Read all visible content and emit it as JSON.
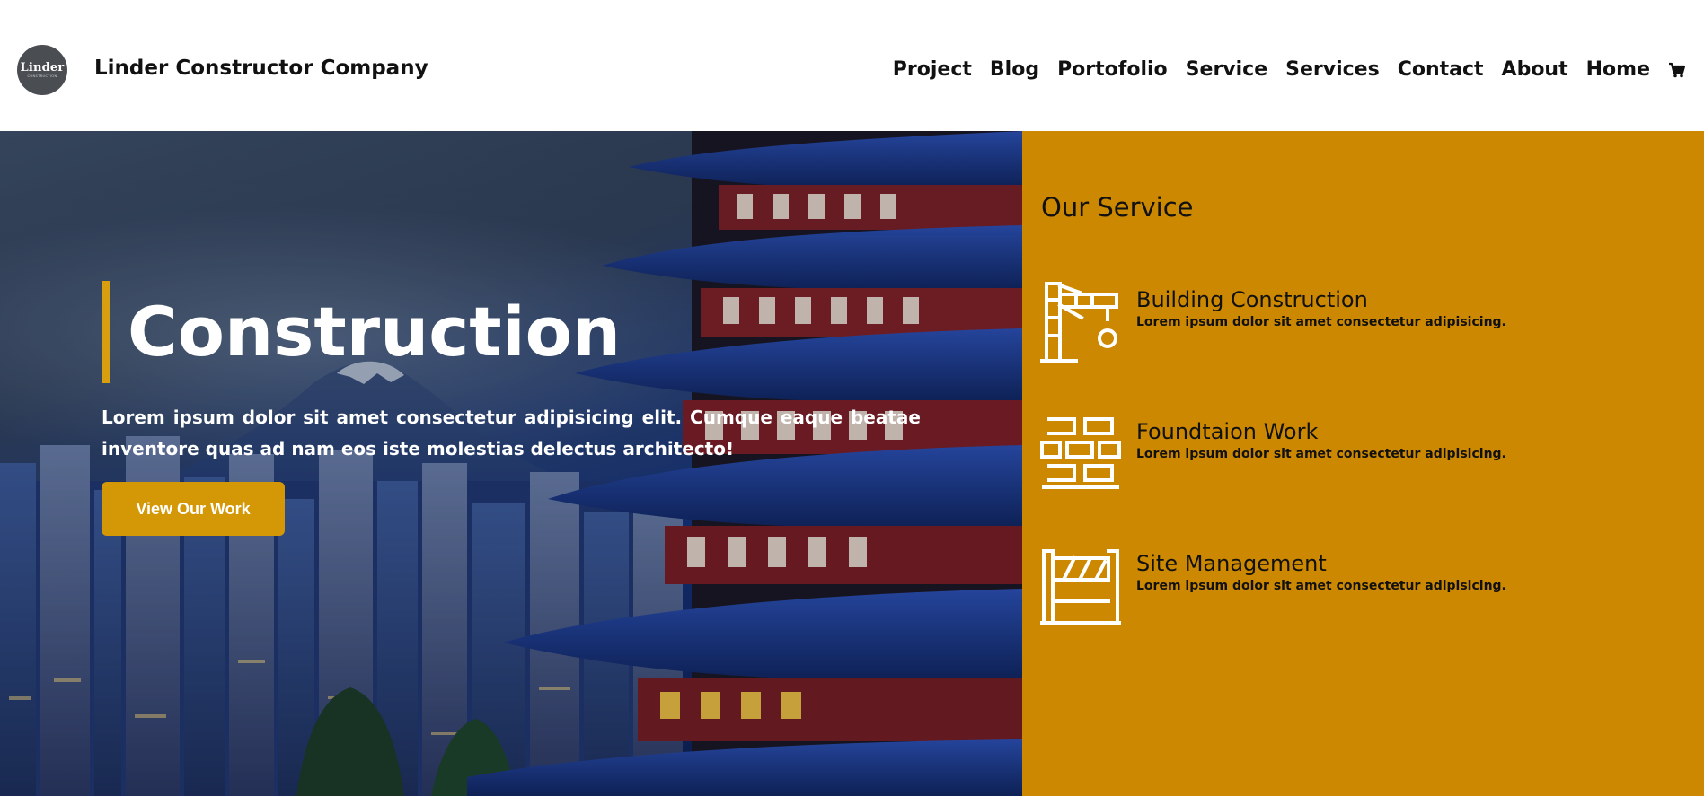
{
  "header": {
    "logo_text": "Linder",
    "logo_subtext": "CONSTRUCTION",
    "brand": "Linder Constructor Company",
    "nav": [
      "Project",
      "Blog",
      "Portofolio",
      "Service",
      "Services",
      "Contact",
      "About",
      "Home"
    ]
  },
  "hero": {
    "title": "Construction",
    "description": "Lorem ipsum dolor sit amet consectetur adipisicing elit. Cumque eaque beatae inventore quas ad nam eos iste molestias delectus architecto!",
    "button_label": "View Our Work"
  },
  "services": {
    "title": "Our Service",
    "items": [
      {
        "name": "Building Construction",
        "desc": "Lorem ipsum dolor sit amet consectetur adipisicing.",
        "icon": "crane-icon"
      },
      {
        "name": "Foundtaion Work",
        "desc": "Lorem ipsum dolor sit amet consectetur adipisicing.",
        "icon": "bricks-icon"
      },
      {
        "name": "Site Management",
        "desc": "Lorem ipsum dolor sit amet consectetur adipisicing.",
        "icon": "barrier-icon"
      }
    ]
  },
  "colors": {
    "accent": "#d49806",
    "panel": "#cc8801",
    "bar": "#d79e10"
  }
}
